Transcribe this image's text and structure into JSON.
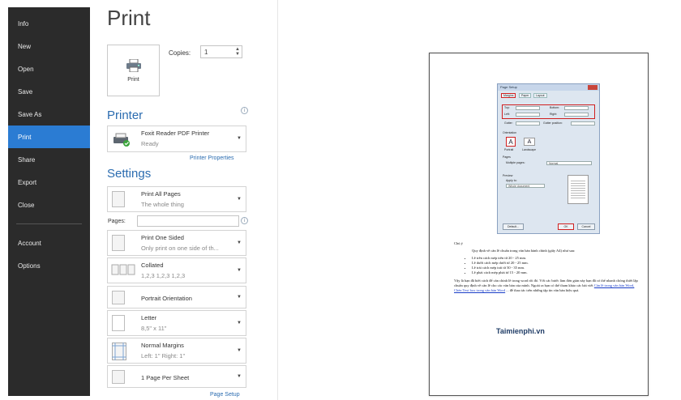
{
  "nav": {
    "items": [
      {
        "label": "Info"
      },
      {
        "label": "New"
      },
      {
        "label": "Open"
      },
      {
        "label": "Save"
      },
      {
        "label": "Save As"
      },
      {
        "label": "Print"
      },
      {
        "label": "Share"
      },
      {
        "label": "Export"
      },
      {
        "label": "Close"
      },
      {
        "label": "Account"
      },
      {
        "label": "Options"
      }
    ],
    "active": "Print",
    "bg_color": "#2b2b2b",
    "active_color": "#2b7cd3"
  },
  "page": {
    "title": "Print",
    "print_button_label": "Print",
    "copies_label": "Copies:",
    "copies_value": "1"
  },
  "printer": {
    "section_title": "Printer",
    "name": "Foxit Reader PDF Printer",
    "status": "Ready",
    "properties_link": "Printer Properties"
  },
  "settings": {
    "section_title": "Settings",
    "pages_label": "Pages:",
    "pages_value": "",
    "dropdowns": [
      {
        "id": "print-range",
        "title": "Print All Pages",
        "subtitle": "The whole thing"
      },
      {
        "id": "sides",
        "title": "Print One Sided",
        "subtitle": "Only print on one side of th..."
      },
      {
        "id": "collation",
        "title": "Collated",
        "subtitle": "1,2,3   1,2,3   1,2,3"
      },
      {
        "id": "orientation",
        "title": "Portrait Orientation",
        "subtitle": ""
      },
      {
        "id": "paper",
        "title": "Letter",
        "subtitle": "8,5\" x 11\""
      },
      {
        "id": "margins",
        "title": "Normal Margins",
        "subtitle": "Left: 1\"   Right: 1\""
      },
      {
        "id": "per-sheet",
        "title": "1 Page Per Sheet",
        "subtitle": ""
      }
    ],
    "page_setup_link": "Page Setup"
  },
  "preview": {
    "dialog_title": "Page Setup",
    "tabs": [
      "Margins",
      "Paper",
      "Layout"
    ],
    "margin_labels": [
      "Top:",
      "Bottom:",
      "Left:",
      "Right:",
      "Gutter:",
      "Gutter position:"
    ],
    "orientation_label": "Orientation",
    "orientation_options": [
      "Portrait",
      "Landscape"
    ],
    "pages_label": "Pages",
    "multiple_pages_label": "Multiple pages:",
    "multiple_pages_value": "Normal",
    "preview_label": "Preview",
    "apply_to_label": "Apply to:",
    "apply_to_value": "Whole document",
    "default_button": "Default...",
    "ok_button": "OK",
    "cancel_button": "Cancel",
    "doc_intro": "Chú ý",
    "doc_heading": "Quy định về căn lề chuẩn trong văn bản hành chính (giấy A4) như sau:",
    "doc_bullets": [
      "Lề trên cách mép trên từ 20 - 25 mm.",
      "Lề dưới cách mép dưới từ 20 - 25 mm.",
      "Lề trái cách mép trái từ 30 - 35 mm.",
      "Lề phải cách mép phải từ 15 - 20 mm."
    ],
    "doc_paragraph": "Vậy là bạn đã biết cách để căn chỉnh lề trong word rồi đó. Với các bước làm đơn giản này bạn đã có thể nhanh chóng thiết lập chuẩn quy định về căn lề cho các văn bản của mình. Ngoài ra bạn có thể tham khảo các bài viết",
    "doc_link": "Căn lề trong văn bản Word, Chèn Text box trong văn bản Word",
    "doc_paragraph_end": "... để thao tác trên những tập tin văn bản hiệu quả.",
    "watermark": "Taimienphi.vn"
  },
  "colors": {
    "accent": "#2b6cb0",
    "preview_border": "#555555",
    "highlight_red": "#d02020"
  }
}
